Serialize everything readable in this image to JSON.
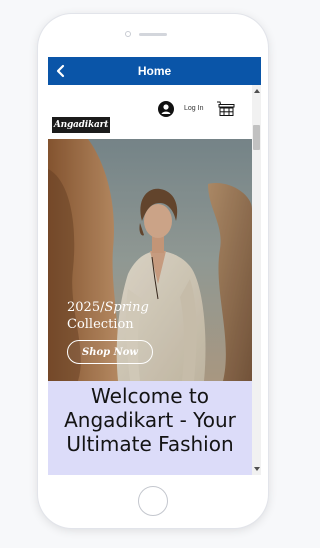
{
  "app_header": {
    "title": "Home"
  },
  "site_nav": {
    "logo_text": "Angadikart",
    "login_label": "Log In"
  },
  "hero": {
    "year": "2025/",
    "season": "Spring",
    "collection": "Collection",
    "cta": "Shop Now"
  },
  "welcome": {
    "heading": "Welcome to Angadikart - Your Ultimate Fashion"
  },
  "colors": {
    "header_bg": "#0a55a8",
    "welcome_bg": "#dcdcf9"
  },
  "icons": [
    "back-chevron-icon",
    "user-icon",
    "cart-icon"
  ]
}
